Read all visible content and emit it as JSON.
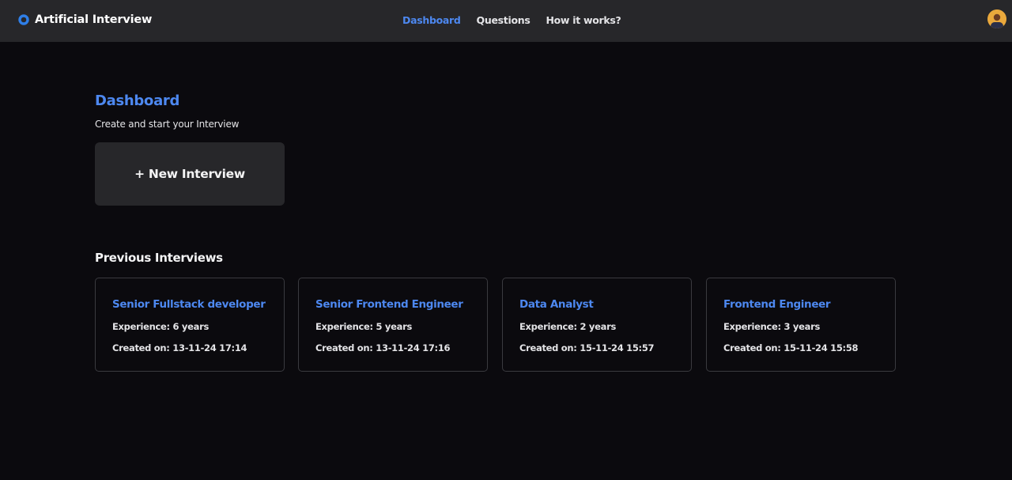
{
  "header": {
    "brand_title": "Artificial Interview",
    "nav": [
      {
        "label": "Dashboard",
        "active": true
      },
      {
        "label": "Questions",
        "active": false
      },
      {
        "label": "How it works?",
        "active": false
      }
    ],
    "brand_icon": "logo-ring-icon",
    "avatar_icon": "user-avatar"
  },
  "main": {
    "title": "Dashboard",
    "subtitle": "Create and start your Interview",
    "new_interview_label": "+ New Interview",
    "previous_title": "Previous Interviews",
    "interviews": [
      {
        "title": "Senior Fullstack developer",
        "experience": "Experience: 6 years",
        "created": "Created on: 13-11-24 17:14"
      },
      {
        "title": "Senior Frontend Engineer",
        "experience": "Experience: 5 years",
        "created": "Created on: 13-11-24 17:16"
      },
      {
        "title": "Data Analyst",
        "experience": "Experience: 2 years",
        "created": "Created on: 15-11-24 15:57"
      },
      {
        "title": "Frontend Engineer",
        "experience": "Experience: 3 years",
        "created": "Created on: 15-11-24 15:58"
      }
    ]
  },
  "colors": {
    "accent": "#4d88f0",
    "background": "#0b0a0e",
    "navbar": "#27272a"
  }
}
